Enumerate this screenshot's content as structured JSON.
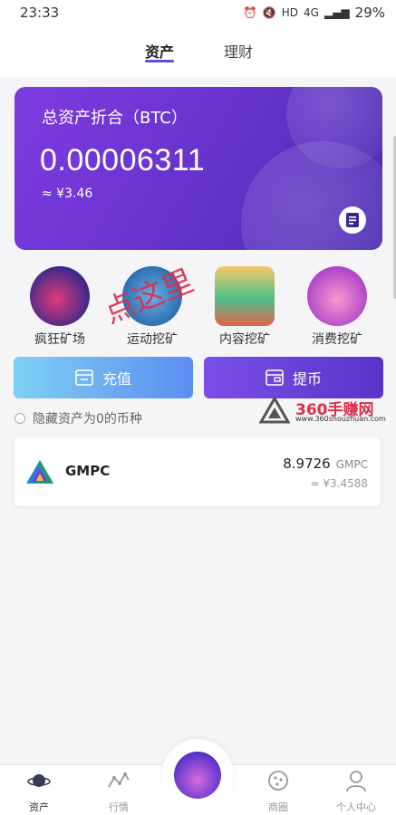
{
  "status": {
    "time": "23:33",
    "network": "4G",
    "hd": "HD",
    "battery": "29%"
  },
  "tabs": [
    {
      "label": "资产",
      "active": true
    },
    {
      "label": "理财",
      "active": false
    }
  ],
  "asset_card": {
    "title": "总资产折合（BTC）",
    "value": "0.00006311",
    "approx": "≈ ¥3.46",
    "record_icon": "document-icon"
  },
  "features": [
    {
      "label": "疯狂矿场",
      "icon": "astronaut-planet-icon"
    },
    {
      "label": "运动挖矿",
      "icon": "sports-planet-icon"
    },
    {
      "label": "内容挖矿",
      "icon": "books-icon"
    },
    {
      "label": "消费挖矿",
      "icon": "shopping-icon"
    }
  ],
  "overlay_text": "点这里",
  "actions": {
    "deposit": "充值",
    "withdraw": "提币"
  },
  "hide_zero": "隐藏资产为0的币种",
  "watermark": {
    "name": "360手赚网",
    "url": "www.360shouzhuan.com"
  },
  "coins": [
    {
      "name": "GMPC",
      "amount": "8.9726",
      "unit": "GMPC",
      "fiat": "≈ ¥3.4588"
    }
  ],
  "bottom_nav": [
    {
      "label": "资产",
      "icon": "planet-icon",
      "active": true
    },
    {
      "label": "行情",
      "icon": "chart-line-icon",
      "active": false
    },
    {
      "label": "",
      "icon": "crystal-gem-icon",
      "active": false
    },
    {
      "label": "商圈",
      "icon": "cookie-icon",
      "active": false
    },
    {
      "label": "个人中心",
      "icon": "person-icon",
      "active": false
    }
  ],
  "colors": {
    "accent": "#5b4fd6",
    "card_start": "#7e3be0",
    "card_end": "#4b2bb0",
    "deposit": "#6fb0f2",
    "withdraw": "#6a40d8"
  }
}
